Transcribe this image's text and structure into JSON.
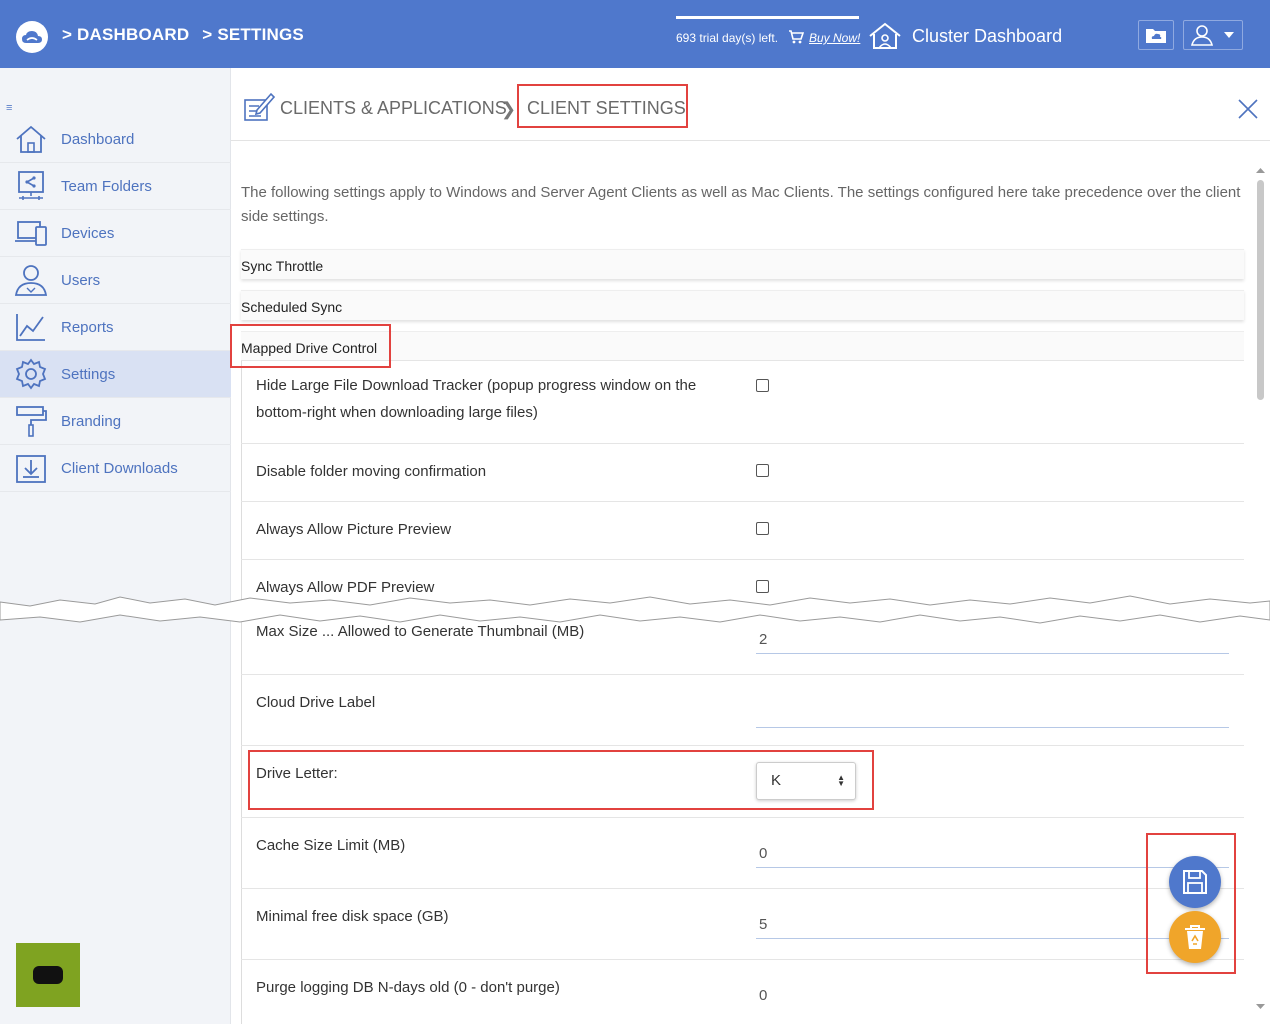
{
  "header": {
    "breadcrumb": [
      "> DASHBOARD",
      "> SETTINGS"
    ],
    "trial_text": "693 trial day(s) left.",
    "buy_now": "Buy Now!",
    "cluster_label": "Cluster Dashboard"
  },
  "sidebar": {
    "items": [
      {
        "label": "Dashboard",
        "icon": "home-icon"
      },
      {
        "label": "Team Folders",
        "icon": "team-folders-icon"
      },
      {
        "label": "Devices",
        "icon": "devices-icon"
      },
      {
        "label": "Users",
        "icon": "users-icon"
      },
      {
        "label": "Reports",
        "icon": "reports-icon"
      },
      {
        "label": "Settings",
        "icon": "gear-icon",
        "active": true
      },
      {
        "label": "Branding",
        "icon": "paint-roller-icon"
      },
      {
        "label": "Client Downloads",
        "icon": "download-icon"
      }
    ]
  },
  "page": {
    "breadcrumb_parent": "CLIENTS & APPLICATIONS",
    "breadcrumb_current": "CLIENT SETTINGS",
    "intro": "The following settings apply to Windows and Server Agent Clients as well as Mac Clients. The settings configured here take precedence over the client side settings."
  },
  "sections": {
    "sync_throttle": "Sync Throttle",
    "scheduled_sync": "Scheduled Sync",
    "mapped_drive_control": "Mapped Drive Control"
  },
  "settings": {
    "hide_tracker": "Hide Large File Download Tracker (popup progress window on the bottom-right when downloading large files)",
    "disable_move_confirm": "Disable folder moving confirmation",
    "allow_picture_preview": "Always Allow Picture Preview",
    "allow_pdf_preview": "Always Allow PDF Preview",
    "max_thumb_label": "Max Size ... Allowed to Generate Thumbnail (MB)",
    "max_thumb_value": "2",
    "cloud_drive_label": "Cloud Drive Label",
    "cloud_drive_value": "",
    "drive_letter_label": "Drive Letter:",
    "drive_letter_value": "K",
    "cache_size_label": "Cache Size Limit (MB)",
    "cache_size_value": "0",
    "min_free_label": "Minimal free disk space (GB)",
    "min_free_value": "5",
    "purge_label": "Purge logging DB N-days old (0 - don't purge)",
    "purge_value": "0"
  },
  "colors": {
    "header_bg": "#4f78cc",
    "accent": "#4e73bf",
    "highlight": "#e2423f",
    "fab_save": "#4f78cc",
    "fab_reset": "#f0a52a",
    "chat": "#7fa321"
  }
}
